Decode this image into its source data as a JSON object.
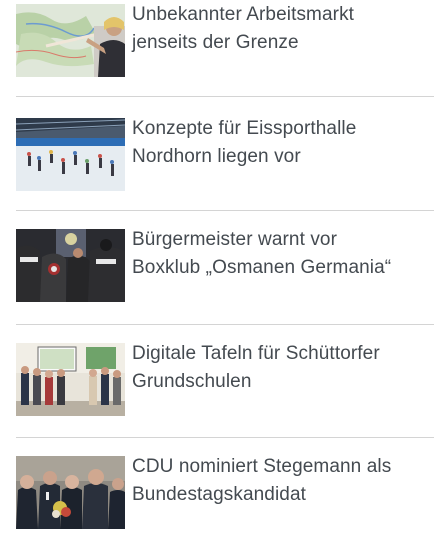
{
  "articles": [
    {
      "image": "teacher-map-photo",
      "headline_line1": "Unbekannter Arbeitsmarkt",
      "headline_line2": "jenseits der Grenze"
    },
    {
      "image": "ice-rink-photo",
      "headline_line1": "Konzepte für Eissporthalle",
      "headline_line2": "Nordhorn liegen vor"
    },
    {
      "image": "police-raid-photo",
      "headline_line1": "Bürgermeister warnt vor",
      "headline_line2": "Boxklub „Osmanen Germania“"
    },
    {
      "image": "classroom-group-photo",
      "headline_line1": "Digitale Tafeln für Schüttorfer",
      "headline_line2": "Grundschulen"
    },
    {
      "image": "politicians-flowers-photo",
      "headline_line1": "CDU nominiert Stegemann als",
      "headline_line2": "Bundestagskandidat"
    }
  ]
}
